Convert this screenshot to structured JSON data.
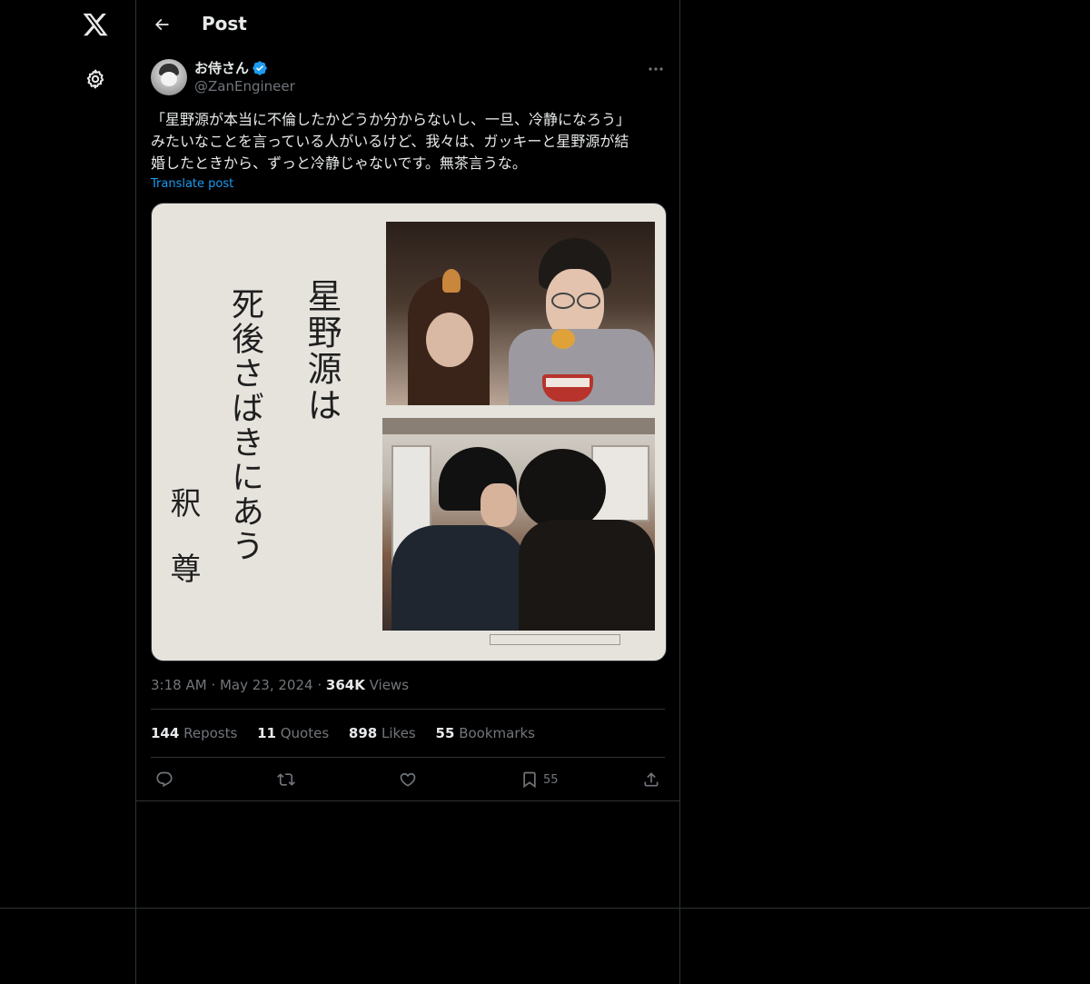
{
  "nav": {
    "logo_icon": "x-logo-icon",
    "settings_icon": "gear-icon"
  },
  "header": {
    "title": "Post",
    "back_icon": "arrow-left-icon"
  },
  "post": {
    "author_name": "お侍さん",
    "verified_icon": "verified-badge-icon",
    "handle": "@ZanEngineer",
    "text": "「星野源が本当に不倫したかどうか分からないし、一旦、冷静になろう」\nみたいなことを言っている人がいるけど、我々は、ガッキーと星野源が結\n婚したときから、ずっと冷静じゃないです。無茶言うな。",
    "translate_label": "Translate post",
    "media": {
      "col1": "星野源は",
      "col2": "死後さばきにあう",
      "col3": "釈　尊"
    },
    "time": "3:18 AM",
    "date": "May 23, 2024",
    "views_count": "364K",
    "views_label": "Views",
    "stats": {
      "reposts_count": "144",
      "reposts_label": "Reposts",
      "quotes_count": "11",
      "quotes_label": "Quotes",
      "likes_count": "898",
      "likes_label": "Likes",
      "bookmarks_count": "55",
      "bookmarks_label": "Bookmarks"
    },
    "actions": {
      "reply_icon": "reply-icon",
      "repost_icon": "repost-icon",
      "like_icon": "heart-icon",
      "bookmark_icon": "bookmark-icon",
      "bookmark_count": "55",
      "share_icon": "share-icon"
    }
  },
  "colors": {
    "background": "#000000",
    "border": "#2f3336",
    "text": "#e7e9ea",
    "muted": "#71767b",
    "accent": "#1d9bf0"
  }
}
